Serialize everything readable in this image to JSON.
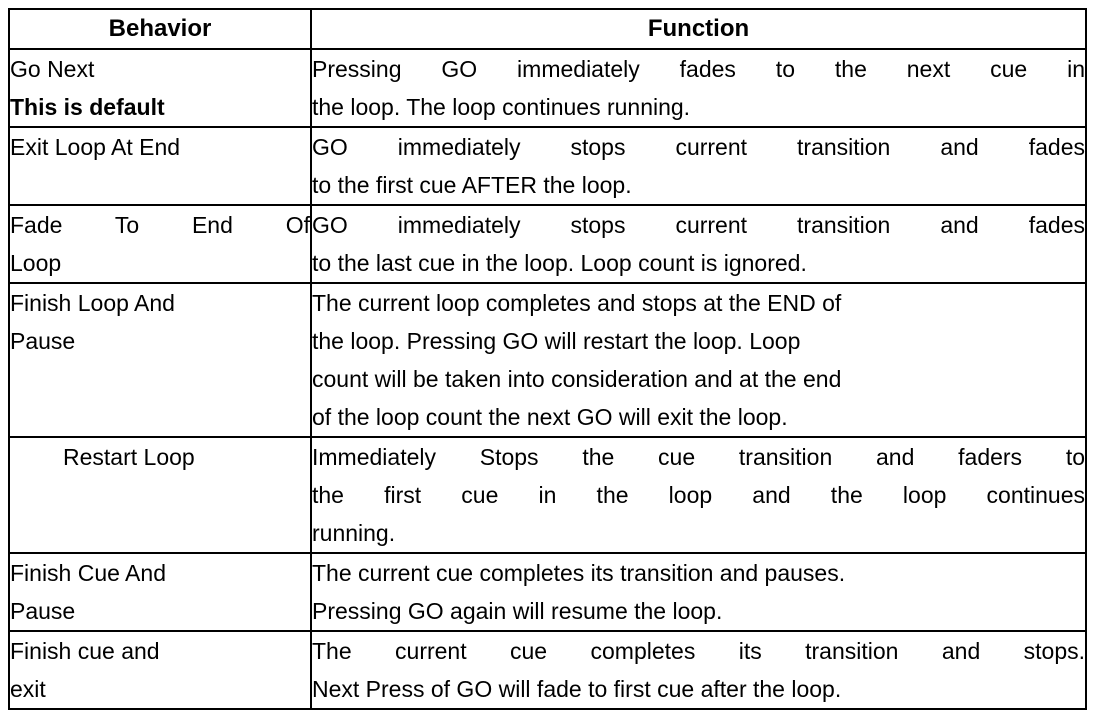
{
  "table": {
    "headers": {
      "behavior": "Behavior",
      "function": "Function"
    },
    "rows": [
      {
        "behavior_lines": [
          {
            "text": "Go Next",
            "bold": false,
            "justify": false
          },
          {
            "text": "This is default",
            "bold": true,
            "justify": false
          }
        ],
        "function_lines": [
          {
            "text": "Pressing GO immediately fades to the next cue in",
            "justify": true
          },
          {
            "text": "the loop. The loop continues running.",
            "justify": false
          }
        ]
      },
      {
        "behavior_lines": [
          {
            "text": "Exit Loop At End",
            "bold": false,
            "justify": false
          }
        ],
        "function_lines": [
          {
            "text": "GO immediately stops current transition and fades",
            "justify": true
          },
          {
            "text": "to the first cue AFTER the loop.",
            "justify": false
          }
        ]
      },
      {
        "behavior_lines": [
          {
            "text": "Fade To End Of",
            "bold": false,
            "justify": true
          },
          {
            "text": "Loop",
            "bold": false,
            "justify": false
          }
        ],
        "function_lines": [
          {
            "text": "GO immediately stops current transition and fades",
            "justify": true
          },
          {
            "text": "to the last cue in the loop. Loop count is ignored.",
            "justify": false
          }
        ]
      },
      {
        "behavior_lines": [
          {
            "text": "Finish Loop And",
            "bold": false,
            "justify": false
          },
          {
            "text": "Pause",
            "bold": false,
            "justify": false
          }
        ],
        "function_lines": [
          {
            "text": "The current loop completes and stops at the END of",
            "justify": false
          },
          {
            "text": "the loop. Pressing GO will restart the loop. Loop",
            "justify": false
          },
          {
            "text": "count will be taken into consideration and at the end",
            "justify": false
          },
          {
            "text": "of the loop count the next GO will exit the loop.",
            "justify": false
          }
        ]
      },
      {
        "behavior_lines": [
          {
            "text": "Restart Loop",
            "bold": false,
            "justify": false
          }
        ],
        "function_lines": [
          {
            "text": "Immediately Stops the cue transition and faders to",
            "justify": true
          },
          {
            "text": "the first cue in the loop and the loop continues",
            "justify": true
          },
          {
            "text": "running.",
            "justify": false
          }
        ]
      },
      {
        "behavior_lines": [
          {
            "text": "Finish Cue And",
            "bold": false,
            "justify": false
          },
          {
            "text": "Pause",
            "bold": false,
            "justify": false
          }
        ],
        "function_lines": [
          {
            "text": "The current cue completes its transition and pauses.",
            "justify": false
          },
          {
            "text": "Pressing GO again will resume the loop.",
            "justify": false
          }
        ]
      },
      {
        "behavior_lines": [
          {
            "text": "Finish cue and",
            "bold": false,
            "justify": false
          },
          {
            "text": "exit",
            "bold": false,
            "justify": false
          }
        ],
        "function_lines": [
          {
            "text": "The current cue completes its transition and stops.",
            "justify": true
          },
          {
            "text": "Next Press of GO will fade to first cue after the loop.",
            "justify": false
          }
        ]
      }
    ]
  },
  "colors": {
    "border": "#000000",
    "text": "#000000",
    "background": "#ffffff"
  }
}
